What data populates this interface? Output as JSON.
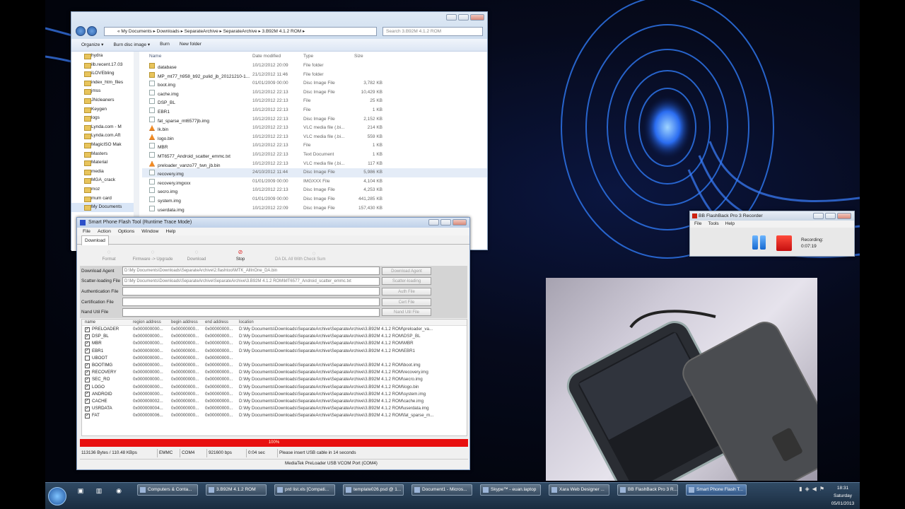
{
  "explorer": {
    "breadcrumb": "« My Documents  ▸  Downloads  ▸  SeparateArchive  ▸  SeparateArchive  ▸  3.B92M 4.1.2 ROM  ▸",
    "search_placeholder": "Search 3.B92M 4.1.2 ROM",
    "toolbar": [
      "Organize ▾",
      "Burn disc image ▾",
      "Burn",
      "New folder"
    ],
    "tree": [
      "hydra",
      "ilb.recent.17.03",
      "iLOVEbling",
      "index_htm_files",
      "jmss",
      "JNcleaners",
      "Keygen",
      "logs",
      "Lynda.com - M",
      "Lynda.com.Aft",
      "MagicISO Mak",
      "Masters",
      "Material",
      "media",
      "MGA_crack",
      "moz",
      "mum card",
      "My Documents"
    ],
    "columns": [
      "Name",
      "Date modified",
      "Type",
      "Size"
    ],
    "files": [
      {
        "name": "database",
        "date": "10/12/2012 20:09",
        "type": "File folder",
        "size": "",
        "icon": "folder"
      },
      {
        "name": "MP_mt77_h958_b92_pulid_jb_20121210-1...",
        "date": "21/12/2012 11:46",
        "type": "File folder",
        "size": "",
        "icon": "folder"
      },
      {
        "name": "boot.img",
        "date": "01/01/2009 00:00",
        "type": "Disc Image File",
        "size": "3,782 KB",
        "icon": "file"
      },
      {
        "name": "cache.img",
        "date": "10/12/2012 22:13",
        "type": "Disc Image File",
        "size": "10,429 KB",
        "icon": "file"
      },
      {
        "name": "DSP_BL",
        "date": "10/12/2012 22:13",
        "type": "File",
        "size": "25 KB",
        "icon": "file"
      },
      {
        "name": "EBR1",
        "date": "10/12/2012 22:13",
        "type": "File",
        "size": "1 KB",
        "icon": "file"
      },
      {
        "name": "fat_sparse_mt6577jb.img",
        "date": "10/12/2012 22:13",
        "type": "Disc Image File",
        "size": "2,152 KB",
        "icon": "file"
      },
      {
        "name": "lk.bin",
        "date": "10/12/2012 22:13",
        "type": "VLC media file (.bi...",
        "size": "214 KB",
        "icon": "vlc"
      },
      {
        "name": "logo.bin",
        "date": "10/12/2012 22:13",
        "type": "VLC media file (.bi...",
        "size": "559 KB",
        "icon": "vlc"
      },
      {
        "name": "MBR",
        "date": "10/12/2012 22:13",
        "type": "File",
        "size": "1 KB",
        "icon": "file"
      },
      {
        "name": "MT6577_Android_scatter_emmc.txt",
        "date": "10/12/2012 22:13",
        "type": "Text Document",
        "size": "1 KB",
        "icon": "file"
      },
      {
        "name": "preloader_vanzo77_twn_jb.bin",
        "date": "10/12/2012 22:13",
        "type": "VLC media file (.bi...",
        "size": "117 KB",
        "icon": "vlc"
      },
      {
        "name": "recovery.img",
        "date": "24/10/2012 11:44",
        "type": "Disc Image File",
        "size": "5,986 KB",
        "icon": "file"
      },
      {
        "name": "recovery.imgxxx",
        "date": "01/01/2009 00:00",
        "type": "IMGXXX File",
        "size": "4,104 KB",
        "icon": "file"
      },
      {
        "name": "secro.img",
        "date": "10/12/2012 22:13",
        "type": "Disc Image File",
        "size": "4,253 KB",
        "icon": "file"
      },
      {
        "name": "system.img",
        "date": "01/01/2009 00:00",
        "type": "Disc Image File",
        "size": "441,285 KB",
        "icon": "file"
      },
      {
        "name": "userdata.img",
        "date": "10/12/2012 22:09",
        "type": "Disc Image File",
        "size": "157,430 KB",
        "icon": "file"
      }
    ]
  },
  "flash": {
    "title": "Smart Phone Flash Tool (Runtime Trace Mode)",
    "menu": [
      "File",
      "Action",
      "Options",
      "Window",
      "Help"
    ],
    "tab": "Download",
    "tools": [
      "Format",
      "Firmware -> Upgrade",
      "Download",
      "Stop"
    ],
    "da_check": "DA DL All With Check Sum",
    "rows": [
      {
        "label": "Download Agent",
        "value": "D:\\My Documents\\Downloads\\SeparateArchive\\2.flashtool\\MTK_AllInOne_DA.bin",
        "button": "Download Agent"
      },
      {
        "label": "Scatter-loading File",
        "value": "D:\\My Documents\\Downloads\\SeparateArchive\\SeparateArchive\\3.B92M 4.1.2 ROM\\MT6577_Android_scatter_emmc.txt",
        "button": "Scatter-loading"
      },
      {
        "label": "Authentication File",
        "value": "",
        "button": "Auth File"
      },
      {
        "label": "Certification File",
        "value": "",
        "button": "Cert File"
      },
      {
        "label": "Nand Util File",
        "value": "",
        "button": "Nand Util File"
      }
    ],
    "table_columns": [
      "name",
      "region address",
      "begin address",
      "end address",
      "location"
    ],
    "partitions": [
      {
        "name": "PRELOADER",
        "checked": true,
        "region": "0x000000000...",
        "begin": "0x00000000...",
        "end": "0x00000000...",
        "location": "D:\\My Documents\\Downloads\\SeparateArchive\\SeparateArchive\\3.B92M 4.1.2 ROM\\preloader_va..."
      },
      {
        "name": "DSP_BL",
        "checked": true,
        "region": "0x000000000...",
        "begin": "0x00000000...",
        "end": "0x00000000...",
        "location": "D:\\My Documents\\Downloads\\SeparateArchive\\SeparateArchive\\3.B92M 4.1.2 ROM\\DSP_BL"
      },
      {
        "name": "MBR",
        "checked": true,
        "region": "0x000000000...",
        "begin": "0x00000000...",
        "end": "0x00000000...",
        "location": "D:\\My Documents\\Downloads\\SeparateArchive\\SeparateArchive\\3.B92M 4.1.2 ROM\\MBR"
      },
      {
        "name": "EBR1",
        "checked": true,
        "region": "0x000000000...",
        "begin": "0x00000000...",
        "end": "0x00000000...",
        "location": "D:\\My Documents\\Downloads\\SeparateArchive\\SeparateArchive\\3.B92M 4.1.2 ROM\\EBR1"
      },
      {
        "name": "UBOOT",
        "checked": false,
        "region": "0x000000000...",
        "begin": "0x00000000...",
        "end": "0x00000000...",
        "location": ""
      },
      {
        "name": "BOOTIMG",
        "checked": true,
        "region": "0x000000000...",
        "begin": "0x00000000...",
        "end": "0x00000000...",
        "location": "D:\\My Documents\\Downloads\\SeparateArchive\\SeparateArchive\\3.B92M 4.1.2 ROM\\boot.img"
      },
      {
        "name": "RECOVERY",
        "checked": true,
        "region": "0x000000000...",
        "begin": "0x00000000...",
        "end": "0x00000000...",
        "location": "D:\\My Documents\\Downloads\\SeparateArchive\\SeparateArchive\\3.B92M 4.1.2 ROM\\recovery.img"
      },
      {
        "name": "SEC_RO",
        "checked": true,
        "region": "0x000000000...",
        "begin": "0x00000000...",
        "end": "0x00000000...",
        "location": "D:\\My Documents\\Downloads\\SeparateArchive\\SeparateArchive\\3.B92M 4.1.2 ROM\\secro.img"
      },
      {
        "name": "LOGO",
        "checked": true,
        "region": "0x000000000...",
        "begin": "0x00000000...",
        "end": "0x00000000...",
        "location": "D:\\My Documents\\Downloads\\SeparateArchive\\SeparateArchive\\3.B92M 4.1.2 ROM\\logo.bin"
      },
      {
        "name": "ANDROID",
        "checked": true,
        "region": "0x000000000...",
        "begin": "0x00000000...",
        "end": "0x00000000...",
        "location": "D:\\My Documents\\Downloads\\SeparateArchive\\SeparateArchive\\3.B92M 4.1.2 ROM\\system.img"
      },
      {
        "name": "CACHE",
        "checked": true,
        "region": "0x000000002...",
        "begin": "0x00000000...",
        "end": "0x00000000...",
        "location": "D:\\My Documents\\Downloads\\SeparateArchive\\SeparateArchive\\3.B92M 4.1.2 ROM\\cache.img"
      },
      {
        "name": "USRDATA",
        "checked": true,
        "region": "0x000000004...",
        "begin": "0x00000000...",
        "end": "0x00000000...",
        "location": "D:\\My Documents\\Downloads\\SeparateArchive\\SeparateArchive\\3.B92M 4.1.2 ROM\\userdata.img"
      },
      {
        "name": "FAT",
        "checked": true,
        "region": "0x000000006...",
        "begin": "0x00000000...",
        "end": "0x00000000...",
        "location": "D:\\My Documents\\Downloads\\SeparateArchive\\SeparateArchive\\3.B92M 4.1.2 ROM\\fat_sparse_m..."
      }
    ],
    "progress_text": "100%",
    "progress": 1.0,
    "status": [
      "113136 Bytes / 110.48 KBps",
      "EMMC",
      "COM4",
      "921600 bps",
      "0:04 sec",
      "Please insert USB cable in 14 seconds"
    ],
    "status2": "MediaTek PreLoader USB VCOM Port (COM4)"
  },
  "recorder": {
    "title": "BB FlashBack Pro 3 Recorder",
    "menu": [
      "File",
      "Tools",
      "Help"
    ],
    "label": "Recording:",
    "time": "0:07:19"
  },
  "taskbar": {
    "items": [
      {
        "label": "Computers & Conta..."
      },
      {
        "label": "3.B92M 4.1.2 ROM"
      },
      {
        "label": "prd list.xls [Compati..."
      },
      {
        "label": "template026.psd @ 1..."
      },
      {
        "label": "Document1 - Micros..."
      },
      {
        "label": "Skype™ - euan.laptop"
      },
      {
        "label": "Xara Web Designer ..."
      },
      {
        "label": "BB FlashBack Pro 3 R..."
      },
      {
        "label": "Smart Phone Flash T..."
      }
    ],
    "time": "18:31",
    "day": "Saturday",
    "date": "05/01/2013"
  },
  "colors": {
    "progress": "#e81010",
    "accent": "#2b4fc9"
  }
}
